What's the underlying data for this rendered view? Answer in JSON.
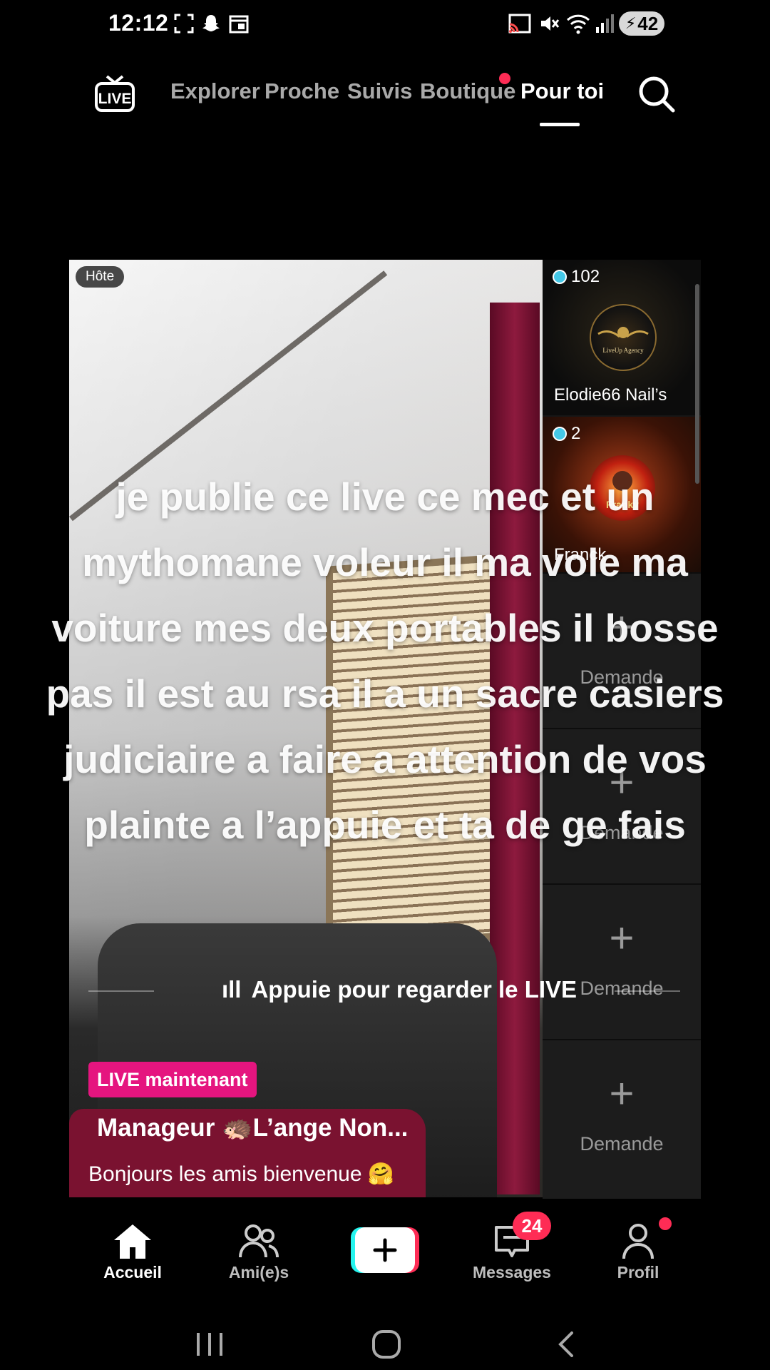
{
  "status_bar": {
    "time": "12:12",
    "battery": "42",
    "icons": [
      "screenshot-icon",
      "snapchat-icon",
      "calendar-icon",
      "cast-icon",
      "mute-icon",
      "wifi-icon",
      "signal-icon"
    ]
  },
  "top_nav": {
    "logo": "LIVE",
    "tabs": [
      {
        "label": "Explorer"
      },
      {
        "label": "Proche"
      },
      {
        "label": "Suivis"
      },
      {
        "label": "Boutique"
      },
      {
        "label": "Pour toi"
      }
    ],
    "active_tab": "Pour toi"
  },
  "stream": {
    "host_badge": "Hôte",
    "caption": "je publie ce live ce mec et un mythomane voleur il ma vole ma voiture mes deux portables il bosse pas il est au rsa il a un sacre casiers judiciaire a faire a attention de vos plainte a l’appuie et ta de ge fais",
    "watch_prompt": "Appuie pour regarder le LIVE",
    "live_now": "LIVE maintenant",
    "streamer_name": "Manageur 🦔L’ange Non...",
    "description": "Bonjours les amis bienvenue 🤗"
  },
  "guests": [
    {
      "viewers": "102",
      "name": "Elodie66 Nail’s",
      "avatar_text": "LiveUp Agency"
    },
    {
      "viewers": "2",
      "name": "Franck",
      "avatar_text": "Franky"
    }
  ],
  "request_slots": [
    {
      "label": "Demande"
    },
    {
      "label": "Demande"
    },
    {
      "label": "Demande"
    },
    {
      "label": "Demande"
    }
  ],
  "bottom_nav": {
    "home": "Accueil",
    "friends": "Ami(e)s",
    "messages": "Messages",
    "messages_badge": "24",
    "profile": "Profil"
  },
  "colors": {
    "accent": "#fe2c55",
    "live_badge": "#e5157f",
    "viewer_dot": "#44c8e8"
  }
}
